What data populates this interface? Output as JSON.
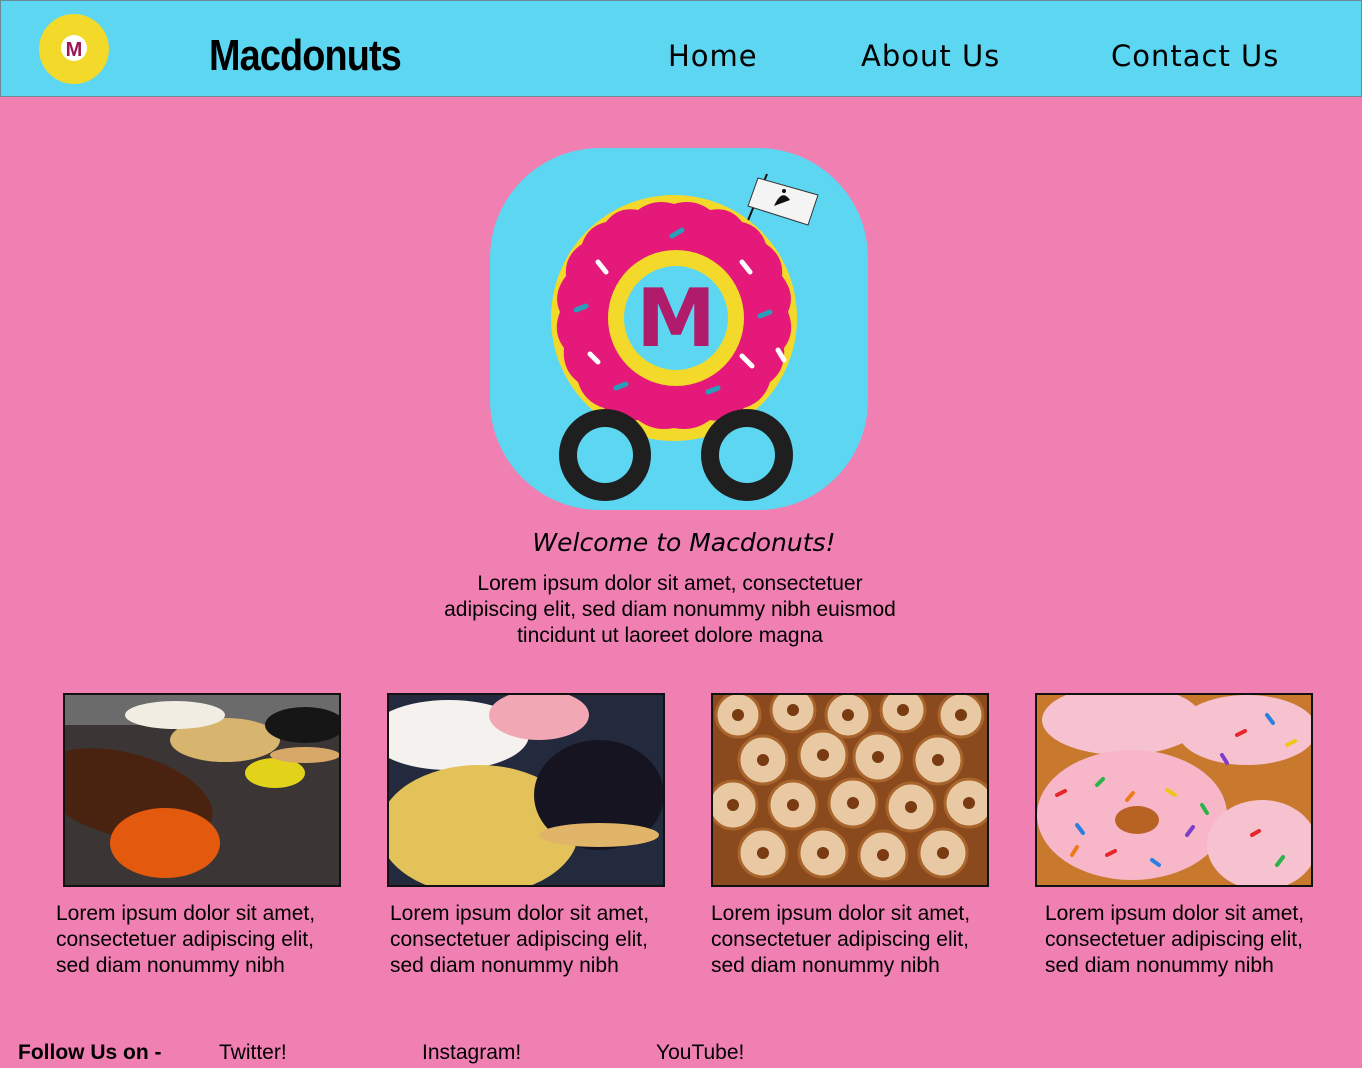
{
  "header": {
    "brand": "Macdonuts",
    "logo_letter": "M",
    "nav": [
      "Home",
      "About Us",
      "Contact Us"
    ]
  },
  "hero": {
    "logo_letter": "M",
    "welcome": "Welcome to Macdonuts!",
    "intro": "Lorem ipsum dolor sit amet, consectetuer adipiscing elit, sed diam nonummy nibh euismod tincidunt ut laoreet dolore magna"
  },
  "cards": [
    {
      "text": "Lorem ipsum dolor sit amet, consectetuer adipiscing elit, sed diam nonummy nibh"
    },
    {
      "text": "Lorem ipsum dolor sit amet, consectetuer adipiscing elit, sed diam nonummy nibh"
    },
    {
      "text": "Lorem ipsum dolor sit amet, consectetuer adipiscing elit, sed diam nonummy nibh"
    },
    {
      "text": "Lorem ipsum dolor sit amet, consectetuer adipiscing elit, sed diam nonummy nibh"
    }
  ],
  "footer": {
    "follow_label": "Follow Us on -",
    "links": [
      "Twitter!",
      "Instagram!",
      "YouTube!"
    ]
  },
  "colors": {
    "page_bg": "#f07fb2",
    "header_bg": "#5dd6f2",
    "donut_icing": "#e4197a",
    "donut_dough": "#f2d92a"
  }
}
